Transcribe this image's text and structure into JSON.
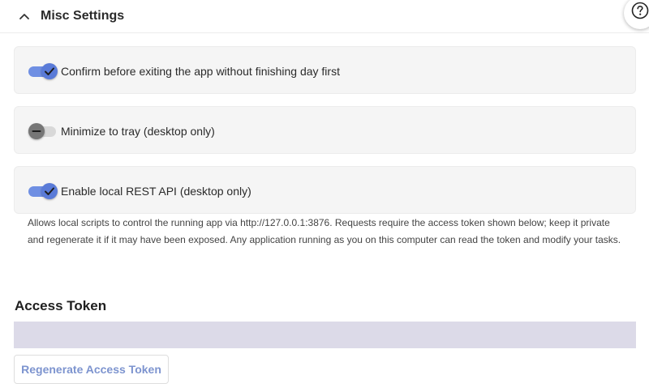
{
  "section": {
    "title": "Misc Settings",
    "collapse_icon": "chevron-up-icon"
  },
  "help_icon": "question-mark-circle-icon",
  "settings": [
    {
      "label": "Confirm before exiting the app without finishing day first",
      "enabled": true
    },
    {
      "label": "Minimize to tray (desktop only)",
      "enabled": false
    },
    {
      "label": "Enable local REST API (desktop only)",
      "enabled": true
    }
  ],
  "rest_api_help": "Allows local scripts to control the running app via http://127.0.0.1:3876. Requests require the access token shown below; keep it private and regenerate it if it may have been exposed. Any application running as you on this computer can read the token and modify your tasks.",
  "access_token": {
    "title": "Access Token",
    "value": "",
    "regenerate_label": "Regenerate Access Token"
  },
  "colors": {
    "toggle_on": "#5a7bd8",
    "toggle_track_on": "#6f8fe3",
    "toggle_off": "#767676",
    "token_field_bg": "#dcdae8",
    "button_text": "#7d94cf"
  }
}
